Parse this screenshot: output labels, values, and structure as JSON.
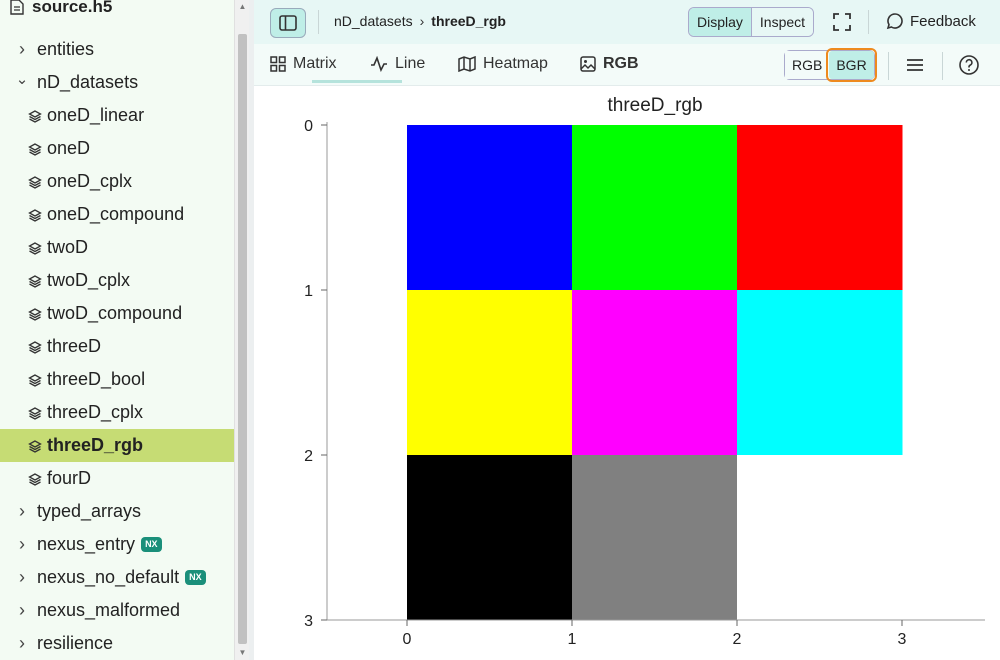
{
  "sidebar": {
    "file_name": "source.h5",
    "items": [
      {
        "label": "entities",
        "type": "group",
        "level": 0,
        "expanded": false
      },
      {
        "label": "nD_datasets",
        "type": "group",
        "level": 0,
        "expanded": true
      },
      {
        "label": "oneD_linear",
        "type": "dataset",
        "level": 1
      },
      {
        "label": "oneD",
        "type": "dataset",
        "level": 1
      },
      {
        "label": "oneD_cplx",
        "type": "dataset",
        "level": 1
      },
      {
        "label": "oneD_compound",
        "type": "dataset",
        "level": 1
      },
      {
        "label": "twoD",
        "type": "dataset",
        "level": 1
      },
      {
        "label": "twoD_cplx",
        "type": "dataset",
        "level": 1
      },
      {
        "label": "twoD_compound",
        "type": "dataset",
        "level": 1
      },
      {
        "label": "threeD",
        "type": "dataset",
        "level": 1
      },
      {
        "label": "threeD_bool",
        "type": "dataset",
        "level": 1
      },
      {
        "label": "threeD_cplx",
        "type": "dataset",
        "level": 1
      },
      {
        "label": "threeD_rgb",
        "type": "dataset",
        "level": 1,
        "selected": true
      },
      {
        "label": "fourD",
        "type": "dataset",
        "level": 1
      },
      {
        "label": "typed_arrays",
        "type": "group",
        "level": 0,
        "expanded": false
      },
      {
        "label": "nexus_entry",
        "type": "group",
        "level": 0,
        "expanded": false,
        "badge": "NX"
      },
      {
        "label": "nexus_no_default",
        "type": "group",
        "level": 0,
        "expanded": false,
        "badge": "NX"
      },
      {
        "label": "nexus_malformed",
        "type": "group",
        "level": 0,
        "expanded": false
      },
      {
        "label": "resilience",
        "type": "group",
        "level": 0,
        "expanded": false
      }
    ]
  },
  "topbar": {
    "breadcrumb_parent": "nD_datasets",
    "breadcrumb_current": "threeD_rgb",
    "mode_display": "Display",
    "mode_inspect": "Inspect",
    "feedback_label": "Feedback"
  },
  "tabs": {
    "items": [
      {
        "label": "Matrix",
        "icon": "grid-icon"
      },
      {
        "label": "Line",
        "icon": "line-chart-icon"
      },
      {
        "label": "Heatmap",
        "icon": "map-icon"
      },
      {
        "label": "RGB",
        "icon": "image-icon",
        "active": true
      }
    ],
    "rgb_label": "RGB",
    "bgr_label": "BGR",
    "selected_channel_order": "BGR"
  },
  "chart_data": {
    "type": "heatmap",
    "title": "threeD_rgb",
    "x_ticks": [
      "0",
      "1",
      "2",
      "3"
    ],
    "y_ticks": [
      "0",
      "1",
      "2",
      "3"
    ],
    "xlim": [
      0,
      3
    ],
    "ylim": [
      0,
      3
    ],
    "cells": [
      {
        "row": 0,
        "col": 0,
        "color": "#0000ff"
      },
      {
        "row": 0,
        "col": 1,
        "color": "#00ff00"
      },
      {
        "row": 0,
        "col": 2,
        "color": "#ff0000"
      },
      {
        "row": 1,
        "col": 0,
        "color": "#ffff00"
      },
      {
        "row": 1,
        "col": 1,
        "color": "#ff00ff"
      },
      {
        "row": 1,
        "col": 2,
        "color": "#00ffff"
      },
      {
        "row": 2,
        "col": 0,
        "color": "#000000"
      },
      {
        "row": 2,
        "col": 1,
        "color": "#808080"
      },
      {
        "row": 2,
        "col": 2,
        "color": "#ffffff"
      }
    ]
  },
  "colors": {
    "accent": "#bfeee7",
    "selected_row": "#c6dc74",
    "focus_outline": "#ee8a1f",
    "nx_badge": "#1a8f7a"
  }
}
